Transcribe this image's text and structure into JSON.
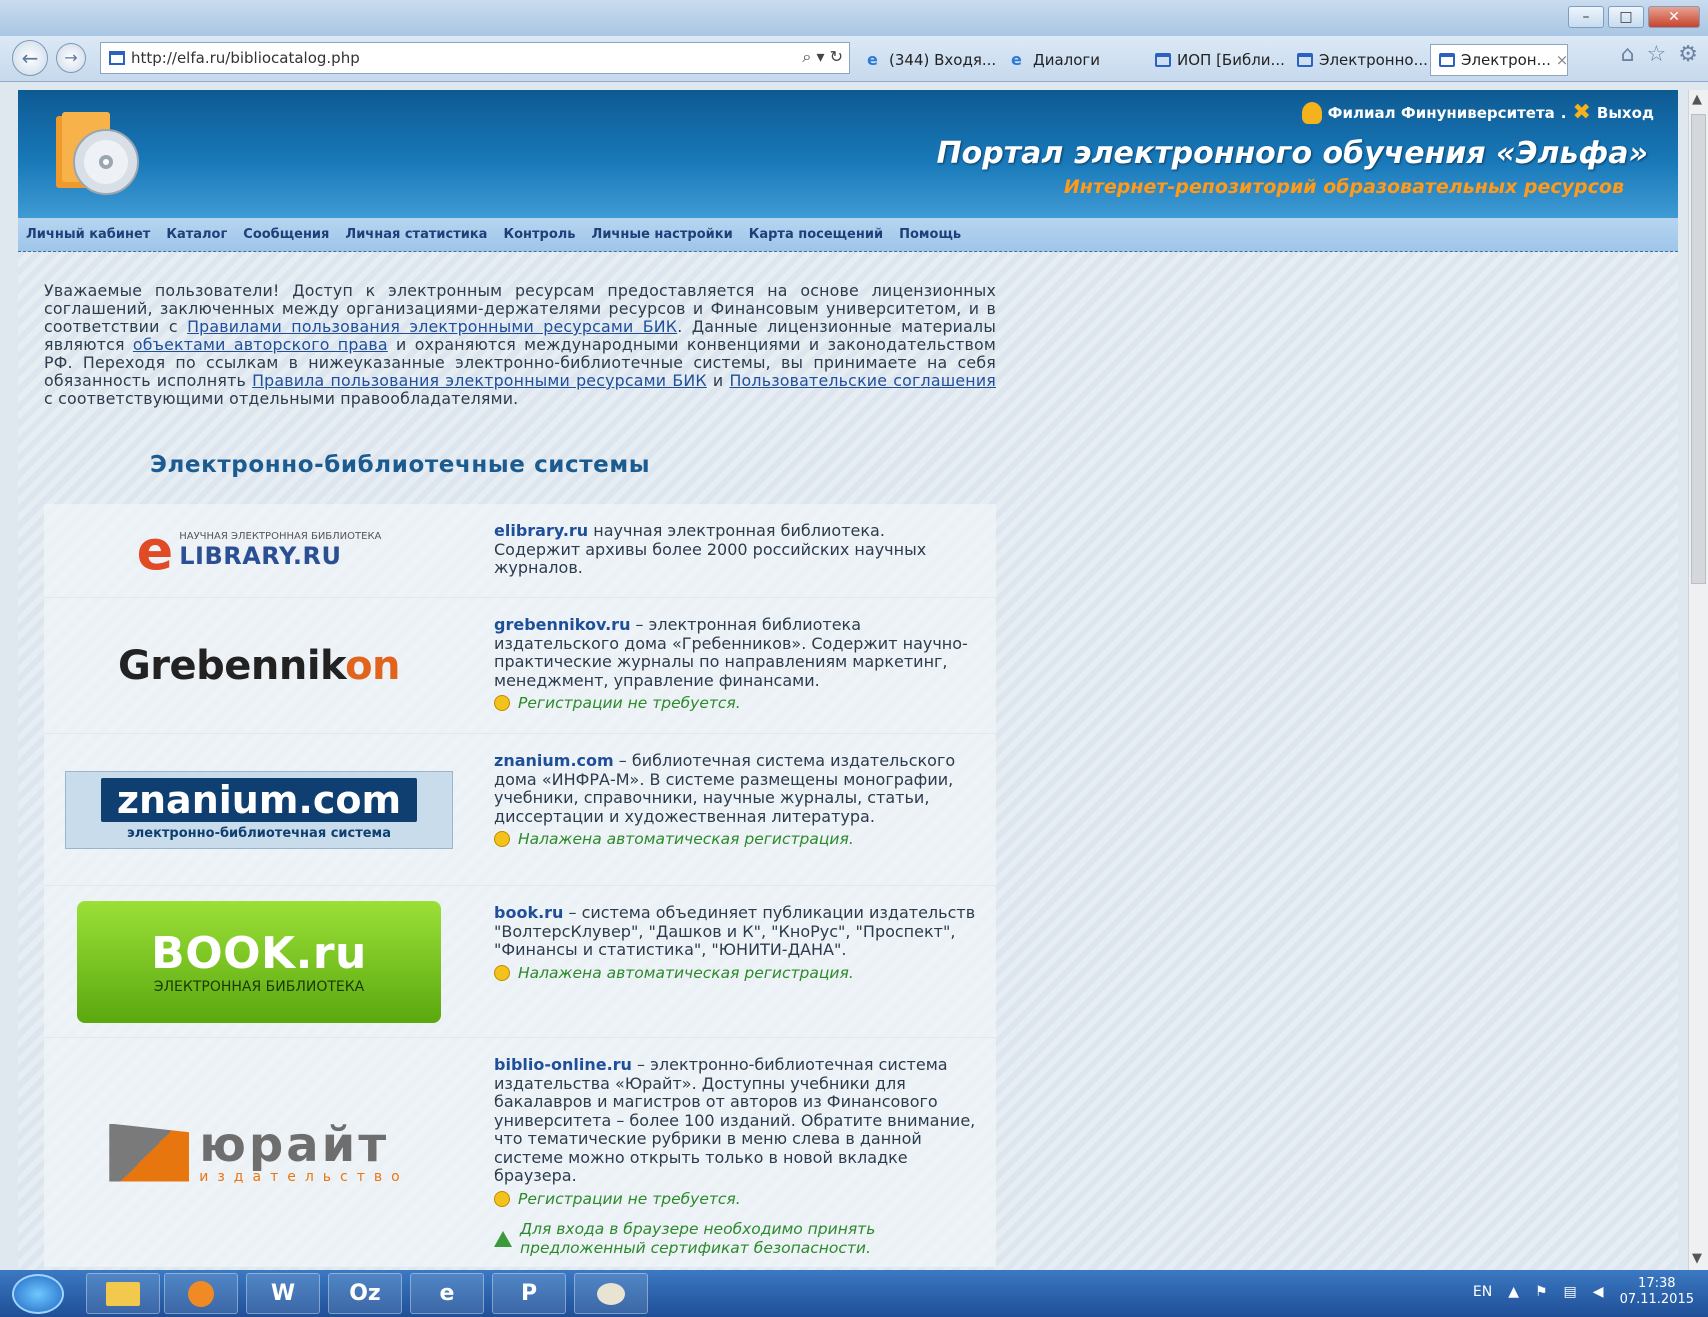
{
  "browser": {
    "url": "http://elfa.ru/bibliocatalog.php",
    "address_tools": "⌕ ▾ ↻",
    "tabs": [
      {
        "label": "(344) Входя...",
        "icon": "ie",
        "active": false
      },
      {
        "label": "Диалоги",
        "icon": "ie",
        "active": false
      },
      {
        "label": "ИОП [Библи...",
        "icon": "page",
        "active": false
      },
      {
        "label": "Электронно...",
        "icon": "page",
        "active": false
      },
      {
        "label": "Электрон...",
        "icon": "page",
        "active": true
      }
    ],
    "close_tab": "×"
  },
  "header": {
    "user": "Филиал Финуниверситета",
    "separator": ".",
    "logout": "Выход",
    "title": "Портал электронного обучения «Эльфа»",
    "subtitle": "Интернет-репозиторий образовательных ресурсов"
  },
  "menu": [
    "Личный кабинет",
    "Каталог",
    "Сообщения",
    "Личная статистика",
    "Контроль",
    "Личные настройки",
    "Карта посещений",
    "Помощь"
  ],
  "intro": {
    "p1": "Уважаемые пользователи! Доступ к электронным ресурсам предоставляется на основе лицензионных соглашений, заключенных между организациями-держателями ресурсов и Финансовым университетом, и в соответствии с ",
    "link1": "Правилами пользования электронными ресурсами БИК",
    "p2": ". Данные лицензионные материалы являются ",
    "link2": "объектами авторского права",
    "p3": " и охраняются международными конвенциями и законодательством РФ. Переходя по ссылкам в нижеуказанные электронно-библиотечные системы, вы принимаете на себя обязанность исполнять ",
    "link3": "Правила пользования электронными ресурсами БИК",
    "p4": " и ",
    "link4": "Пользовательские соглашения",
    "p5": " с соответствующими отдельными правообладателями."
  },
  "section_title": "Электронно-библиотечные системы",
  "systems": [
    {
      "name": "elibrary.ru",
      "desc": " научная электронная библиотека. Содержит архивы более 2000 российских научных журналов.",
      "note": "",
      "logo": {
        "small": "НАУЧНАЯ ЭЛЕКТРОННАЯ БИБЛИОТЕКА",
        "big": "LIBRARY.RU",
        "e": "e"
      }
    },
    {
      "name": "grebennikov.ru",
      "desc": " – электронная библиотека издательского дома «Гребенников». Содержит научно-практические журналы по направлениям маркетинг, менеджмент, управление финансами.",
      "note": "Регистрации не требуется.",
      "logo": {
        "main": "Grebennik",
        "accent": "on"
      }
    },
    {
      "name": "znanium.com",
      "desc": " – библиотечная система издательского дома «ИНФРА-М». В системе размещены монографии, учебники, справочники, научные журналы, статьи, диссертации и художественная литература.",
      "note": "Налажена автоматическая регистрация.",
      "logo": {
        "main": "znanium.com",
        "sub": "электронно-библиотечная система"
      }
    },
    {
      "name": "book.ru",
      "desc": " – система объединяет публикации издательств \"ВолтерсКлувер\", \"Дашков и К\", \"КноРус\", \"Проспект\", \"Финансы и статистика\", \"ЮНИТИ-ДАНА\".",
      "note": "Налажена автоматическая регистрация.",
      "logo": {
        "main": "BOOK.ru",
        "sub": "ЭЛЕКТРОННАЯ БИБЛИОТЕКА"
      }
    },
    {
      "name": "biblio-online.ru",
      "desc": " – электронно-библиотечная система издательства «Юрайт». Доступны учебники для бакалавров и магистров от авторов из Финансового университета – более 100 изданий. Обратите внимание, что тематические рубрики в меню слева в данной системе можно открыть только в новой вкладке браузера.",
      "note": "Регистрации не требуется.",
      "warning": "Для входа в браузере необходимо принять предложенный сертификат безопасности.",
      "logo": {
        "main": "юрайт",
        "sub": "издательство"
      }
    }
  ],
  "taskbar": {
    "apps": [
      "",
      "",
      "W",
      "Oz",
      "e",
      "P",
      ""
    ],
    "lang": "EN",
    "time": "17:38",
    "date": "07.11.2015"
  },
  "colors": {
    "header": "#1878b8",
    "accent": "#ff9a1a",
    "link": "#1f4f9a",
    "note": "#2c8a2c"
  }
}
